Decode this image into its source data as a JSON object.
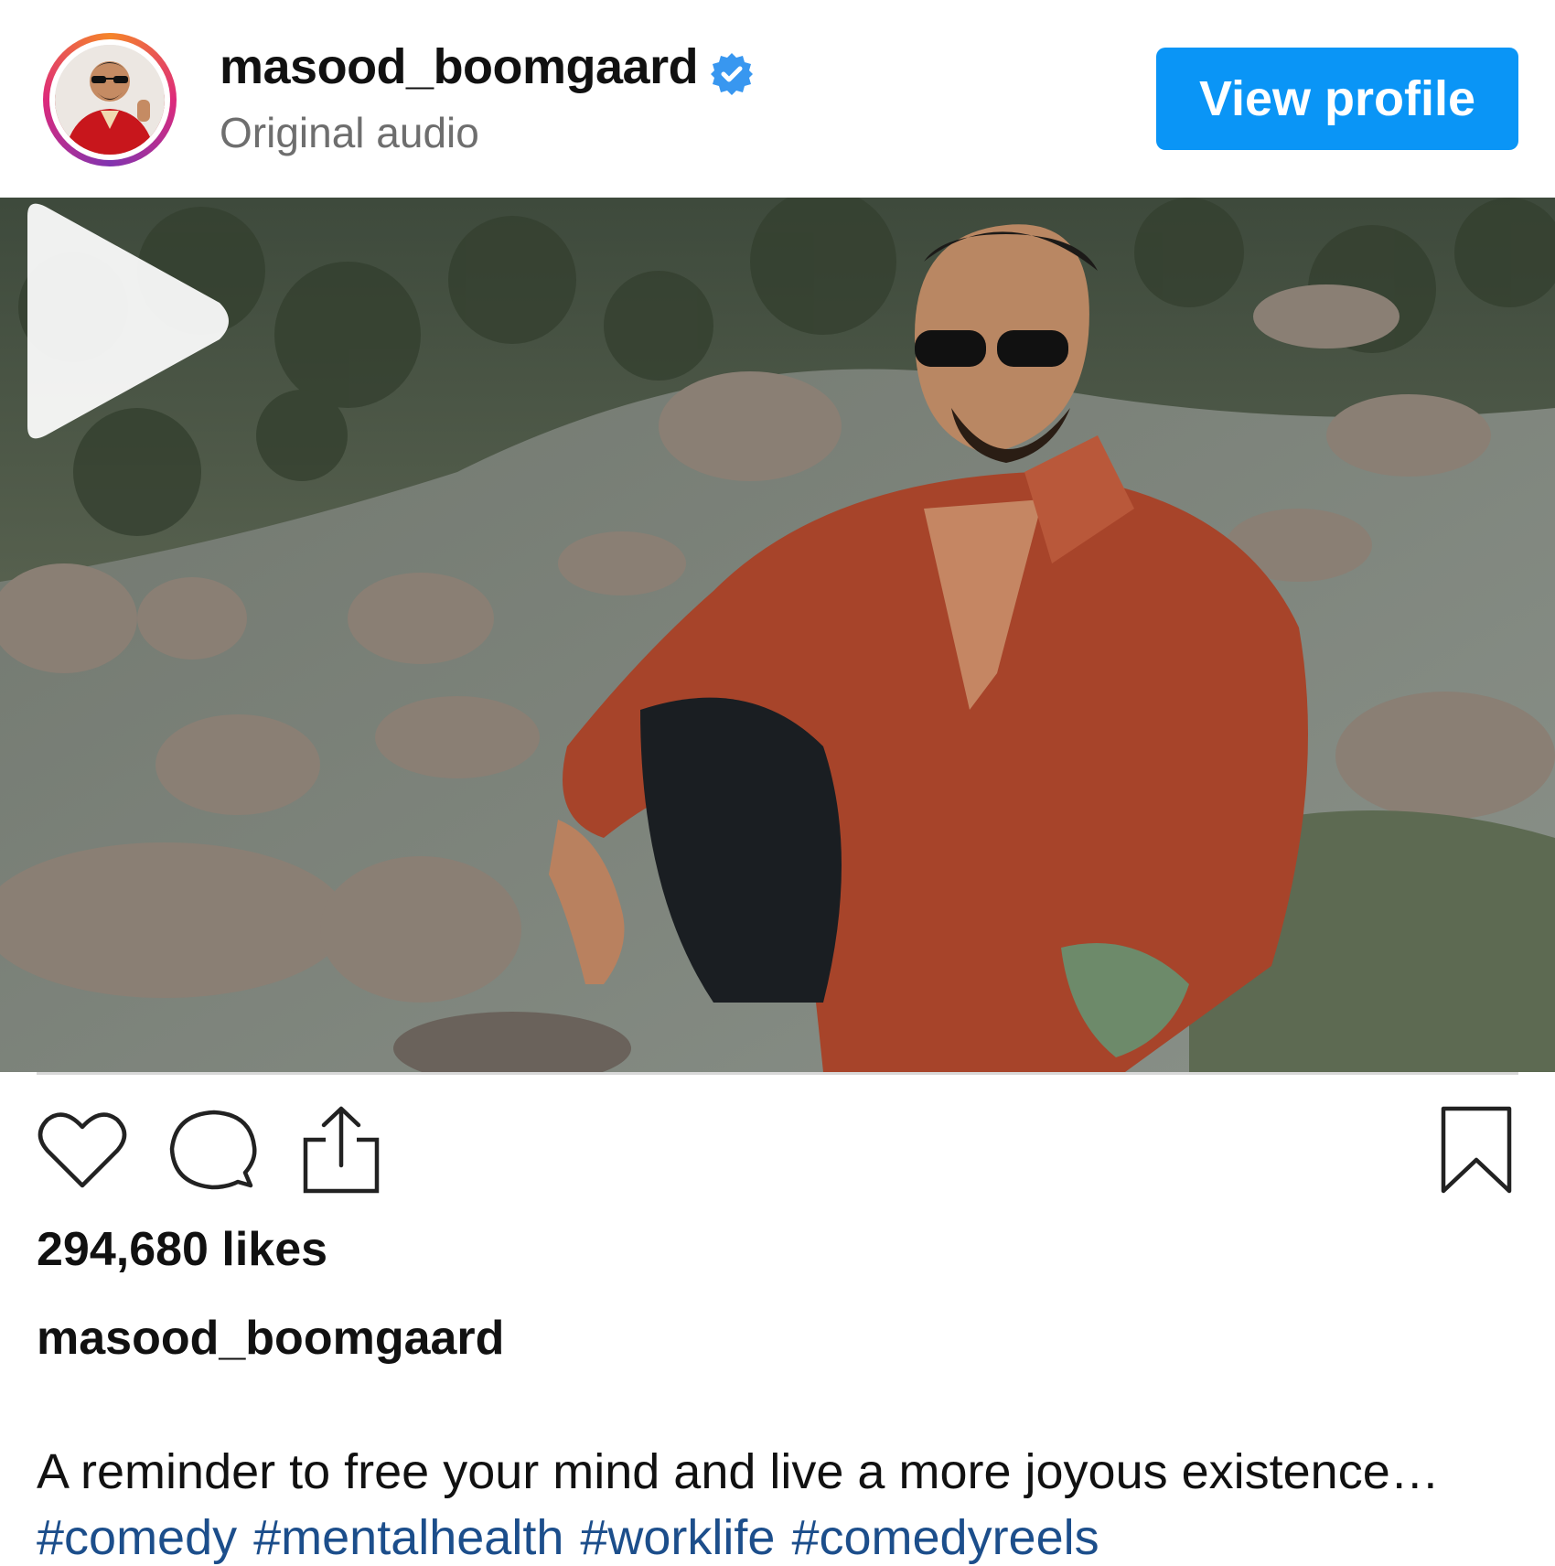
{
  "header": {
    "username": "masood_boomgaard",
    "verified": true,
    "subtitle": "Original audio",
    "view_profile_label": "View profile"
  },
  "media": {
    "type": "video",
    "icons": [
      "play-icon"
    ]
  },
  "actions": {
    "icons": [
      "heart-icon",
      "comment-icon",
      "share-icon",
      "bookmark-icon"
    ]
  },
  "post": {
    "likes": "294,680 likes",
    "caption_username": "masood_boomgaard",
    "caption_text": "A reminder to free your mind and live a more joyous existence…",
    "hashtags": [
      "#comedy",
      "#mentalhealth",
      "#worklife",
      "#comedyreels"
    ]
  },
  "colors": {
    "accent": "#0a95f6",
    "hashtag": "#1c4e8b",
    "secondary_text": "#6e6e6e"
  }
}
